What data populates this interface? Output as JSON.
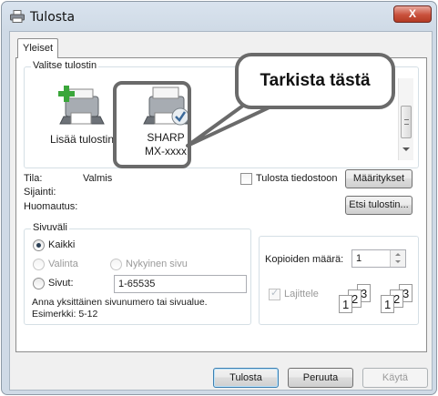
{
  "window": {
    "title": "Tulosta",
    "close_label": "X"
  },
  "tabs": [
    {
      "label": "Yleiset"
    }
  ],
  "select_printer": {
    "legend": "Valitse tulostin",
    "printers": [
      {
        "label": "Lisää tulostin"
      },
      {
        "label_line1": "SHARP",
        "label_line2": "MX-xxxx"
      }
    ],
    "callout": "Tarkista tästä"
  },
  "status": {
    "state_label": "Tila:",
    "state_value": "Valmis",
    "location_label": "Sijainti:",
    "comment_label": "Huomautus:",
    "print_to_file": "Tulosta tiedostoon",
    "preferences_button": "Määritykset",
    "find_printer_button": "Etsi tulostin..."
  },
  "page_range": {
    "legend": "Sivuväli",
    "all": "Kaikki",
    "selection": "Valinta",
    "current_page": "Nykyinen sivu",
    "pages": "Sivut:",
    "pages_value": "1-65535",
    "hint_line1": "Anna yksittäinen sivunumero tai sivualue.",
    "hint_line2": "Esimerkki: 5-12"
  },
  "copies": {
    "label": "Kopioiden määrä:",
    "value": "1",
    "collate": "Lajittele",
    "collate_digits": [
      "1",
      "2",
      "3"
    ]
  },
  "buttons": {
    "print": "Tulosta",
    "cancel": "Peruuta",
    "apply": "Käytä"
  }
}
